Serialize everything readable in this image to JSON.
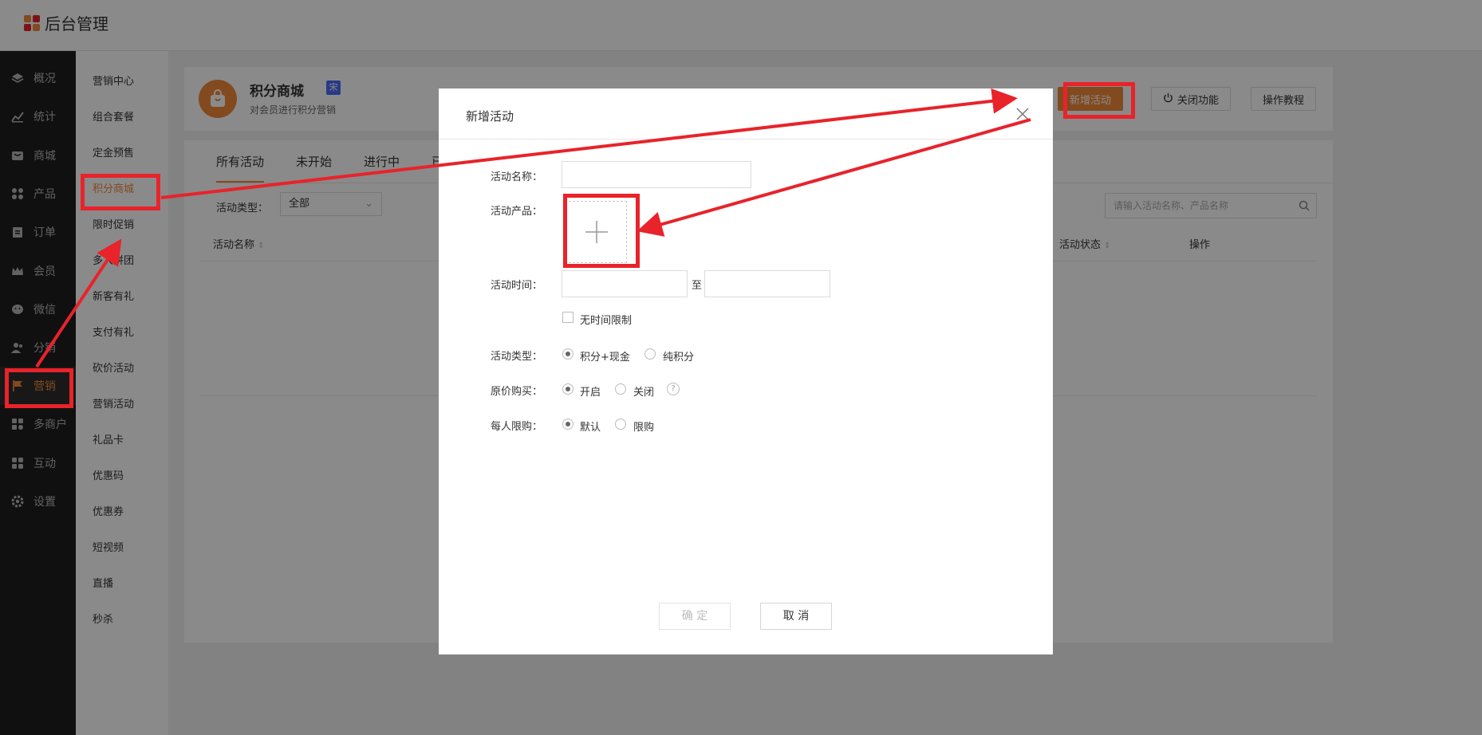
{
  "app": {
    "title": "后台管理"
  },
  "main_nav": [
    {
      "label": "概况",
      "icon": "layers-icon"
    },
    {
      "label": "统计",
      "icon": "chart-icon"
    },
    {
      "label": "商城",
      "icon": "shop-icon"
    },
    {
      "label": "产品",
      "icon": "grid-icon"
    },
    {
      "label": "订单",
      "icon": "clipboard-icon"
    },
    {
      "label": "会员",
      "icon": "crown-icon"
    },
    {
      "label": "微信",
      "icon": "wechat-icon"
    },
    {
      "label": "分销",
      "icon": "users-icon"
    },
    {
      "label": "营销",
      "icon": "flag-icon",
      "active": true
    },
    {
      "label": "多商户",
      "icon": "store-icon"
    },
    {
      "label": "互动",
      "icon": "apps-icon"
    },
    {
      "label": "设置",
      "icon": "gear-icon"
    }
  ],
  "sub_nav": [
    "营销中心",
    "组合套餐",
    "定金预售",
    "积分商城",
    "限时促销",
    "多人拼团",
    "新客有礼",
    "支付有礼",
    "砍价活动",
    "营销活动",
    "礼品卡",
    "优惠码",
    "优惠券",
    "短视频",
    "直播",
    "秒杀"
  ],
  "header": {
    "title": "积分商城",
    "badge": "宋",
    "desc": "对会员进行积分营销",
    "add_btn": "新增活动",
    "close_btn": "关闭功能",
    "tutorial_btn": "操作教程"
  },
  "tabs": [
    "所有活动",
    "未开始",
    "进行中",
    "已"
  ],
  "filter": {
    "label": "活动类型：",
    "value": "全部"
  },
  "search": {
    "placeholder": "请输入活动名称、产品名称"
  },
  "table_headers": {
    "name": "活动名称",
    "status": "活动状态",
    "ops": "操作"
  },
  "modal": {
    "title": "新增活动",
    "name_label": "活动名称：",
    "product_label": "活动产品：",
    "time_label": "活动时间：",
    "time_sep": "至",
    "no_limit": "无时间限制",
    "type_label": "活动类型：",
    "type_opt1": "积分+现金",
    "type_opt2": "纯积分",
    "origin_label": "原价购买：",
    "origin_opt1": "开启",
    "origin_opt2": "关闭",
    "help": "?",
    "limit_label": "每人限购：",
    "limit_opt1": "默认",
    "limit_opt2": "限购",
    "confirm": "确 定",
    "cancel": "取 消"
  },
  "colors": {
    "accent": "#f08a38",
    "annotation": "#e8232a",
    "sidebar": "#1f1f1f"
  }
}
